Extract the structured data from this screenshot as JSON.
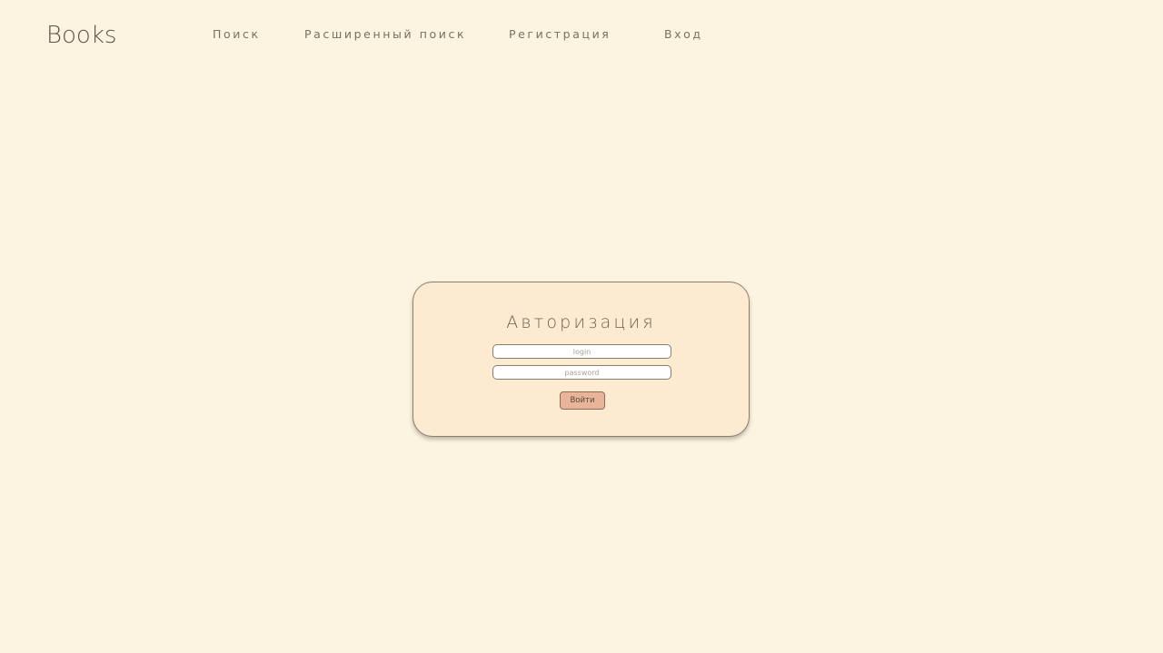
{
  "header": {
    "logo": "Books",
    "nav": {
      "search": "Поиск",
      "advanced_search": "Расширенный поиск",
      "register": "Регистрация",
      "login": "Вход"
    }
  },
  "auth": {
    "title": "Авторизация",
    "login_placeholder": "login",
    "password_placeholder": "password",
    "submit_label": "Войти"
  },
  "colors": {
    "background": "#fdf3e1",
    "card": "#fcebd0",
    "border": "#8b7e6e",
    "button": "#e8b59a",
    "text": "#6b5e4f"
  }
}
